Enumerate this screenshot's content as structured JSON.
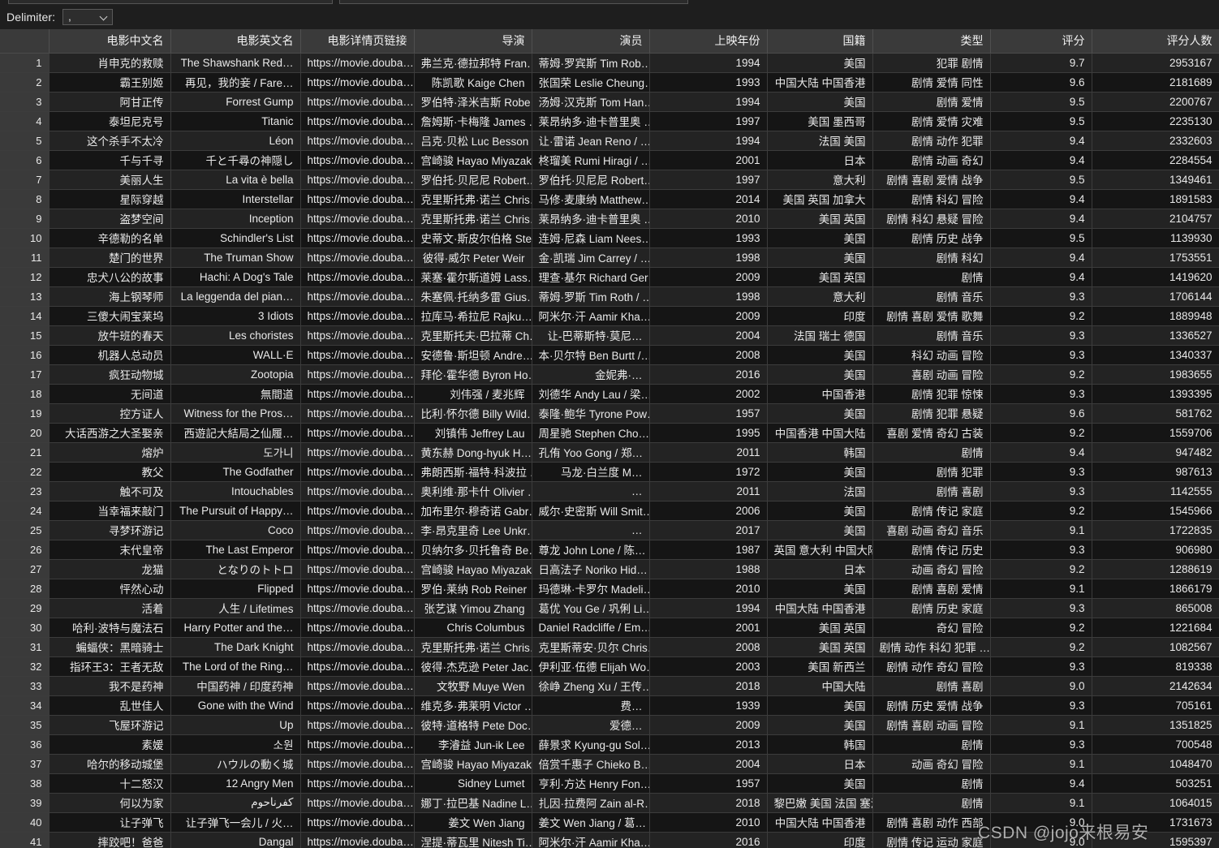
{
  "toolbar": {
    "delimiter_label": "Delimiter:",
    "delimiter_value": ",",
    "chevron_icon": "chevron-down-icon"
  },
  "watermark": "CSDN @jojo来根易安",
  "table": {
    "rownum_header": "",
    "columns": [
      "电影中文名",
      "电影英文名",
      "电影详情页链接",
      "导演",
      "演员",
      "上映年份",
      "国籍",
      "类型",
      "评分",
      "评分人数"
    ],
    "rows": [
      {
        "n": "1",
        "cn": "肖申克的救赎",
        "en": "The Shawshank Red…",
        "url": "https://movie.douba…",
        "dir": "弗兰克·德拉邦特 Fran…",
        "act": "蒂姆·罗宾斯 Tim Rob…",
        "year": "1994",
        "nat": "美国",
        "genre": "犯罪 剧情",
        "score": "9.7",
        "votes": "2953167"
      },
      {
        "n": "2",
        "cn": "霸王别姬",
        "en": "再见，我的妾 / Fare…",
        "url": "https://movie.douba…",
        "dir": "陈凯歌 Kaige Chen",
        "act": "张国荣 Leslie Cheung…",
        "year": "1993",
        "nat": "中国大陆 中国香港",
        "genre": "剧情 爱情 同性",
        "score": "9.6",
        "votes": "2181689"
      },
      {
        "n": "3",
        "cn": "阿甘正传",
        "en": "Forrest Gump",
        "url": "https://movie.douba…",
        "dir": "罗伯特·泽米吉斯 Robe…",
        "act": "汤姆·汉克斯 Tom Han…",
        "year": "1994",
        "nat": "美国",
        "genre": "剧情 爱情",
        "score": "9.5",
        "votes": "2200767"
      },
      {
        "n": "4",
        "cn": "泰坦尼克号",
        "en": "Titanic",
        "url": "https://movie.douba…",
        "dir": "詹姆斯·卡梅隆 James …",
        "act": "莱昂纳多·迪卡普里奥 …",
        "year": "1997",
        "nat": "美国 墨西哥",
        "genre": "剧情 爱情 灾难",
        "score": "9.5",
        "votes": "2235130"
      },
      {
        "n": "5",
        "cn": "这个杀手不太冷",
        "en": "Léon",
        "url": "https://movie.douba…",
        "dir": "吕克·贝松 Luc Besson",
        "act": "让·雷诺 Jean Reno / …",
        "year": "1994",
        "nat": "法国 美国",
        "genre": "剧情 动作 犯罪",
        "score": "9.4",
        "votes": "2332603"
      },
      {
        "n": "6",
        "cn": "千与千寻",
        "en": "千と千尋の神隠し",
        "url": "https://movie.douba…",
        "dir": "宫崎骏 Hayao Miyazaki",
        "act": "柊瑠美 Rumi Hiragi / …",
        "year": "2001",
        "nat": "日本",
        "genre": "剧情 动画 奇幻",
        "score": "9.4",
        "votes": "2284554"
      },
      {
        "n": "7",
        "cn": "美丽人生",
        "en": "La vita è bella",
        "url": "https://movie.douba…",
        "dir": "罗伯托·贝尼尼 Robert…",
        "act": "罗伯托·贝尼尼 Robert…",
        "year": "1997",
        "nat": "意大利",
        "genre": "剧情 喜剧 爱情 战争",
        "score": "9.5",
        "votes": "1349461"
      },
      {
        "n": "8",
        "cn": "星际穿越",
        "en": "Interstellar",
        "url": "https://movie.douba…",
        "dir": "克里斯托弗·诺兰 Chris…",
        "act": "马修·麦康纳 Matthew…",
        "year": "2014",
        "nat": "美国 英国 加拿大",
        "genre": "剧情 科幻 冒险",
        "score": "9.4",
        "votes": "1891583"
      },
      {
        "n": "9",
        "cn": "盗梦空间",
        "en": "Inception",
        "url": "https://movie.douba…",
        "dir": "克里斯托弗·诺兰 Chris…",
        "act": "莱昂纳多·迪卡普里奥 …",
        "year": "2010",
        "nat": "美国 英国",
        "genre": "剧情 科幻 悬疑 冒险",
        "score": "9.4",
        "votes": "2104757"
      },
      {
        "n": "10",
        "cn": "辛德勒的名单",
        "en": "Schindler's List",
        "url": "https://movie.douba…",
        "dir": "史蒂文·斯皮尔伯格 Ste…",
        "act": "连姆·尼森 Liam Nees…",
        "year": "1993",
        "nat": "美国",
        "genre": "剧情 历史 战争",
        "score": "9.5",
        "votes": "1139930"
      },
      {
        "n": "11",
        "cn": "楚门的世界",
        "en": "The Truman Show",
        "url": "https://movie.douba…",
        "dir": "彼得·威尔 Peter Weir",
        "act": "金·凯瑞 Jim Carrey / …",
        "year": "1998",
        "nat": "美国",
        "genre": "剧情 科幻",
        "score": "9.4",
        "votes": "1753551"
      },
      {
        "n": "12",
        "cn": "忠犬八公的故事",
        "en": "Hachi: A Dog's Tale",
        "url": "https://movie.douba…",
        "dir": "莱塞·霍尔斯道姆 Lass…",
        "act": "理查·基尔 Richard Ger…",
        "year": "2009",
        "nat": "美国 英国",
        "genre": "剧情",
        "score": "9.4",
        "votes": "1419620"
      },
      {
        "n": "13",
        "cn": "海上钢琴师",
        "en": "La leggenda del pian…",
        "url": "https://movie.douba…",
        "dir": "朱塞佩·托纳多雷 Gius…",
        "act": "蒂姆·罗斯 Tim Roth / …",
        "year": "1998",
        "nat": "意大利",
        "genre": "剧情 音乐",
        "score": "9.3",
        "votes": "1706144"
      },
      {
        "n": "14",
        "cn": "三傻大闹宝莱坞",
        "en": "3 Idiots",
        "url": "https://movie.douba…",
        "dir": "拉库马·希拉尼 Rajku…",
        "act": "阿米尔·汗 Aamir Kha…",
        "year": "2009",
        "nat": "印度",
        "genre": "剧情 喜剧 爱情 歌舞",
        "score": "9.2",
        "votes": "1889948"
      },
      {
        "n": "15",
        "cn": "放牛班的春天",
        "en": "Les choristes",
        "url": "https://movie.douba…",
        "dir": "克里斯托夫·巴拉蒂 Ch…",
        "act": "让-巴蒂斯特·莫尼…",
        "year": "2004",
        "nat": "法国 瑞士 德国",
        "genre": "剧情 音乐",
        "score": "9.3",
        "votes": "1336527"
      },
      {
        "n": "16",
        "cn": "机器人总动员",
        "en": "WALL·E",
        "url": "https://movie.douba…",
        "dir": "安德鲁·斯坦顿 Andre…",
        "act": "本·贝尔特 Ben Burtt /…",
        "year": "2008",
        "nat": "美国",
        "genre": "科幻 动画 冒险",
        "score": "9.3",
        "votes": "1340337"
      },
      {
        "n": "17",
        "cn": "疯狂动物城",
        "en": "Zootopia",
        "url": "https://movie.douba…",
        "dir": "拜伦·霍华德 Byron Ho…",
        "act": "金妮弗·…",
        "year": "2016",
        "nat": "美国",
        "genre": "喜剧 动画 冒险",
        "score": "9.2",
        "votes": "1983655"
      },
      {
        "n": "18",
        "cn": "无间道",
        "en": "無間道",
        "url": "https://movie.douba…",
        "dir": "刘伟强 / 麦兆辉",
        "act": "刘德华 Andy Lau / 梁…",
        "year": "2002",
        "nat": "中国香港",
        "genre": "剧情 犯罪 惊悚",
        "score": "9.3",
        "votes": "1393395"
      },
      {
        "n": "19",
        "cn": "控方证人",
        "en": "Witness for the Pros…",
        "url": "https://movie.douba…",
        "dir": "比利·怀尔德 Billy Wild…",
        "act": "泰隆·鲍华 Tyrone Pow…",
        "year": "1957",
        "nat": "美国",
        "genre": "剧情 犯罪 悬疑",
        "score": "9.6",
        "votes": "581762"
      },
      {
        "n": "20",
        "cn": "大话西游之大圣娶亲",
        "en": "西遊記大結局之仙履…",
        "url": "https://movie.douba…",
        "dir": "刘镇伟 Jeffrey Lau",
        "act": "周星驰 Stephen Cho…",
        "year": "1995",
        "nat": "中国香港 中国大陆",
        "genre": "喜剧 爱情 奇幻 古装",
        "score": "9.2",
        "votes": "1559706"
      },
      {
        "n": "21",
        "cn": "熔炉",
        "en": "도가니",
        "url": "https://movie.douba…",
        "dir": "黄东赫 Dong-hyuk H…",
        "act": "孔侑 Yoo Gong / 郑…",
        "year": "2011",
        "nat": "韩国",
        "genre": "剧情",
        "score": "9.4",
        "votes": "947482"
      },
      {
        "n": "22",
        "cn": "教父",
        "en": "The Godfather",
        "url": "https://movie.douba…",
        "dir": "弗朗西斯·福特·科波拉 …",
        "act": "马龙·白兰度 M…",
        "year": "1972",
        "nat": "美国",
        "genre": "剧情 犯罪",
        "score": "9.3",
        "votes": "987613"
      },
      {
        "n": "23",
        "cn": "触不可及",
        "en": "Intouchables",
        "url": "https://movie.douba…",
        "dir": "奥利维·那卡什 Olivier …",
        "act": "…",
        "year": "2011",
        "nat": "法国",
        "genre": "剧情 喜剧",
        "score": "9.3",
        "votes": "1142555"
      },
      {
        "n": "24",
        "cn": "当幸福来敲门",
        "en": "The Pursuit of Happy…",
        "url": "https://movie.douba…",
        "dir": "加布里尔·穆奇诺 Gabr…",
        "act": "威尔·史密斯 Will Smit…",
        "year": "2006",
        "nat": "美国",
        "genre": "剧情 传记 家庭",
        "score": "9.2",
        "votes": "1545966"
      },
      {
        "n": "25",
        "cn": "寻梦环游记",
        "en": "Coco",
        "url": "https://movie.douba…",
        "dir": "李·昂克里奇 Lee Unkr…",
        "act": "…",
        "year": "2017",
        "nat": "美国",
        "genre": "喜剧 动画 奇幻 音乐",
        "score": "9.1",
        "votes": "1722835"
      },
      {
        "n": "26",
        "cn": "末代皇帝",
        "en": "The Last Emperor",
        "url": "https://movie.douba…",
        "dir": "贝纳尔多·贝托鲁奇 Be…",
        "act": "尊龙 John Lone / 陈…",
        "year": "1987",
        "nat": "英国 意大利 中国大陆 …",
        "genre": "剧情 传记 历史",
        "score": "9.3",
        "votes": "906980"
      },
      {
        "n": "27",
        "cn": "龙猫",
        "en": "となりのトトロ",
        "url": "https://movie.douba…",
        "dir": "宫崎骏 Hayao Miyazaki",
        "act": "日高法子 Noriko Hid…",
        "year": "1988",
        "nat": "日本",
        "genre": "动画 奇幻 冒险",
        "score": "9.2",
        "votes": "1288619"
      },
      {
        "n": "28",
        "cn": "怦然心动",
        "en": "Flipped",
        "url": "https://movie.douba…",
        "dir": "罗伯·莱纳 Rob Reiner",
        "act": "玛德琳·卡罗尔 Madeli…",
        "year": "2010",
        "nat": "美国",
        "genre": "剧情 喜剧 爱情",
        "score": "9.1",
        "votes": "1866179"
      },
      {
        "n": "29",
        "cn": "活着",
        "en": "人生 / Lifetimes",
        "url": "https://movie.douba…",
        "dir": "张艺谋 Yimou Zhang",
        "act": "葛优 You Ge / 巩俐 Li…",
        "year": "1994",
        "nat": "中国大陆 中国香港",
        "genre": "剧情 历史 家庭",
        "score": "9.3",
        "votes": "865008"
      },
      {
        "n": "30",
        "cn": "哈利·波特与魔法石",
        "en": "Harry Potter and the…",
        "url": "https://movie.douba…",
        "dir": "Chris Columbus",
        "act": "Daniel Radcliffe / Em…",
        "year": "2001",
        "nat": "美国 英国",
        "genre": "奇幻 冒险",
        "score": "9.2",
        "votes": "1221684"
      },
      {
        "n": "31",
        "cn": "蝙蝠侠：黑暗骑士",
        "en": "The Dark Knight",
        "url": "https://movie.douba…",
        "dir": "克里斯托弗·诺兰 Chris…",
        "act": "克里斯蒂安·贝尔 Chris…",
        "year": "2008",
        "nat": "美国 英国",
        "genre": "剧情 动作 科幻 犯罪 …",
        "score": "9.2",
        "votes": "1082567"
      },
      {
        "n": "32",
        "cn": "指环王3：王者无敌",
        "en": "The Lord of the Ring…",
        "url": "https://movie.douba…",
        "dir": "彼得·杰克逊 Peter Jac…",
        "act": "伊利亚·伍德 Elijah Wo…",
        "year": "2003",
        "nat": "美国 新西兰",
        "genre": "剧情 动作 奇幻 冒险",
        "score": "9.3",
        "votes": "819338"
      },
      {
        "n": "33",
        "cn": "我不是药神",
        "en": "中国药神 / 印度药神",
        "url": "https://movie.douba…",
        "dir": "文牧野 Muye Wen",
        "act": "徐峥 Zheng Xu / 王传…",
        "year": "2018",
        "nat": "中国大陆",
        "genre": "剧情 喜剧",
        "score": "9.0",
        "votes": "2142634"
      },
      {
        "n": "34",
        "cn": "乱世佳人",
        "en": "Gone with the Wind",
        "url": "https://movie.douba…",
        "dir": "维克多·弗莱明 Victor …",
        "act": "费…",
        "year": "1939",
        "nat": "美国",
        "genre": "剧情 历史 爱情 战争",
        "score": "9.3",
        "votes": "705161"
      },
      {
        "n": "35",
        "cn": "飞屋环游记",
        "en": "Up",
        "url": "https://movie.douba…",
        "dir": "彼特·道格特 Pete Doc…",
        "act": "爱德…",
        "year": "2009",
        "nat": "美国",
        "genre": "剧情 喜剧 动画 冒险",
        "score": "9.1",
        "votes": "1351825"
      },
      {
        "n": "36",
        "cn": "素媛",
        "en": "소원",
        "url": "https://movie.douba…",
        "dir": "李濬益 Jun-ik Lee",
        "act": "薛景求 Kyung-gu Sol…",
        "year": "2013",
        "nat": "韩国",
        "genre": "剧情",
        "score": "9.3",
        "votes": "700548"
      },
      {
        "n": "37",
        "cn": "哈尔的移动城堡",
        "en": "ハウルの動く城",
        "url": "https://movie.douba…",
        "dir": "宫崎骏 Hayao Miyazaki",
        "act": "倍赏千惠子 Chieko B…",
        "year": "2004",
        "nat": "日本",
        "genre": "动画 奇幻 冒险",
        "score": "9.1",
        "votes": "1048470"
      },
      {
        "n": "38",
        "cn": "十二怒汉",
        "en": "12 Angry Men",
        "url": "https://movie.douba…",
        "dir": "Sidney Lumet",
        "act": "亨利·方达 Henry Fon…",
        "year": "1957",
        "nat": "美国",
        "genre": "剧情",
        "score": "9.4",
        "votes": "503251"
      },
      {
        "n": "39",
        "cn": "何以为家",
        "en": "كفرناحوم",
        "url": "https://movie.douba…",
        "dir": "娜丁·拉巴基 Nadine L…",
        "act": "扎因·拉费阿 Zain al-R…",
        "year": "2018",
        "nat": "黎巴嫩 美国 法国 塞浦…",
        "genre": "剧情",
        "score": "9.1",
        "votes": "1064015"
      },
      {
        "n": "40",
        "cn": "让子弹飞",
        "en": "让子弹飞一会儿 / 火…",
        "url": "https://movie.douba…",
        "dir": "姜文 Wen Jiang",
        "act": "姜文 Wen Jiang / 葛…",
        "year": "2010",
        "nat": "中国大陆 中国香港",
        "genre": "剧情 喜剧 动作 西部",
        "score": "9.0",
        "votes": "1731673"
      },
      {
        "n": "41",
        "cn": "摔跤吧！爸爸",
        "en": "Dangal",
        "url": "https://movie.douba…",
        "dir": "涅提·蒂瓦里 Nitesh Ti…",
        "act": "阿米尔·汗 Aamir Kha…",
        "year": "2016",
        "nat": "印度",
        "genre": "剧情 传记 运动 家庭",
        "score": "9.0",
        "votes": "1595397"
      }
    ]
  }
}
